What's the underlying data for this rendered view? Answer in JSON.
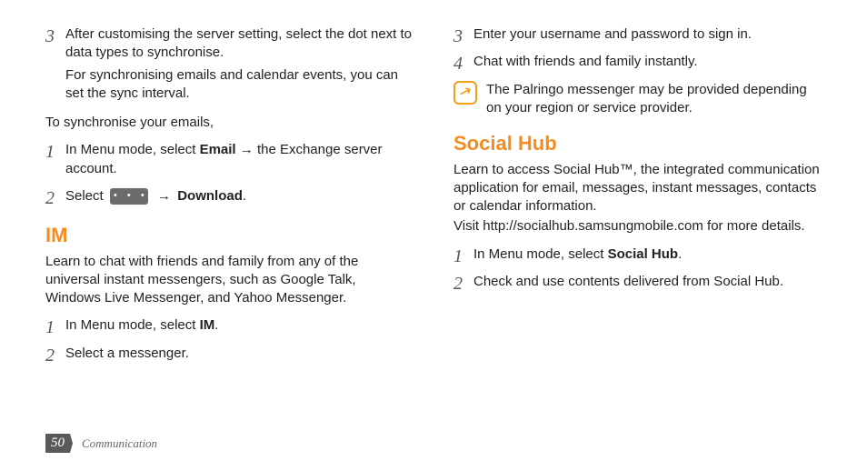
{
  "left": {
    "step3": {
      "num": "3",
      "line1": "After customising the server setting, select the dot next to data types to synchronise.",
      "line2": "For synchronising emails and calendar events, you can set the sync interval."
    },
    "syncIntro": "To synchronise your emails,",
    "sync1": {
      "num": "1",
      "prefix": "In Menu mode, select ",
      "bold": "Email",
      "suffix": " → the Exchange server account."
    },
    "sync2": {
      "num": "2",
      "prefix": "Select ",
      "arrow": " → ",
      "bold": "Download",
      "suffix": "."
    },
    "imTitle": "IM",
    "imIntro": "Learn to chat with friends and family from any of the universal instant messengers, such as Google Talk, Windows Live Messenger, and Yahoo Messenger.",
    "im1": {
      "num": "1",
      "prefix": "In Menu mode, select ",
      "bold": "IM",
      "suffix": "."
    },
    "im2": {
      "num": "2",
      "text": "Select a messenger."
    }
  },
  "right": {
    "step3": {
      "num": "3",
      "text": "Enter your username and password to sign in."
    },
    "step4": {
      "num": "4",
      "text": "Chat with friends and family instantly."
    },
    "note": "The Palringo messenger may be provided depending on your region or service provider.",
    "shTitle": "Social Hub",
    "shIntro1": "Learn to access Social Hub™, the integrated communication application for email, messages, instant messages, contacts or calendar information.",
    "shIntro2": "Visit http://socialhub.samsungmobile.com for more details.",
    "sh1": {
      "num": "1",
      "prefix": "In Menu mode, select ",
      "bold": "Social Hub",
      "suffix": "."
    },
    "sh2": {
      "num": "2",
      "text": "Check and use contents delivered from Social Hub."
    }
  },
  "footer": {
    "pageNum": "50",
    "section": "Communication"
  },
  "glyphs": {
    "dots": "• • •"
  }
}
